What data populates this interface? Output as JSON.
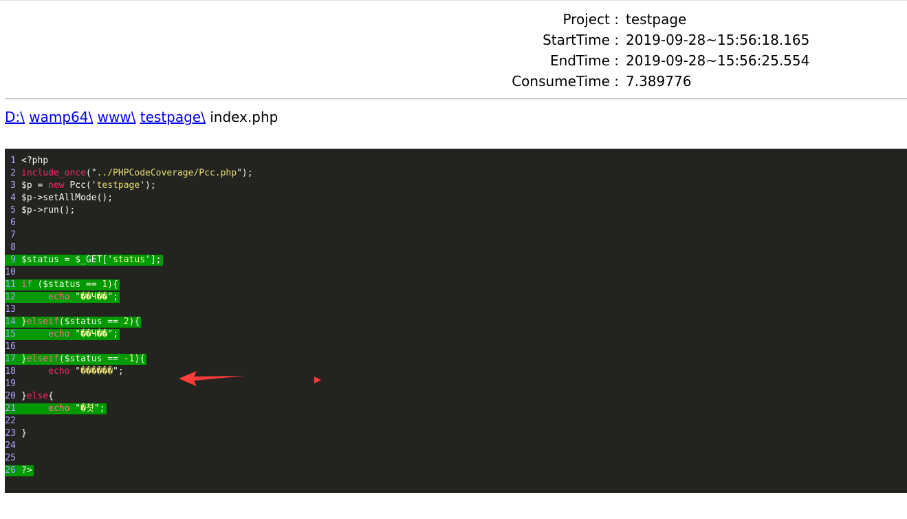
{
  "meta": {
    "project_label": "Project :",
    "project": "testpage",
    "start_label": "StartTime :",
    "start": "2019-09-28~15:56:18.165",
    "end_label": "EndTime :",
    "end": "2019-09-28~15:56:25.554",
    "consume_label": "ConsumeTime :",
    "consume": "7.389776"
  },
  "breadcrumb": {
    "items": [
      "D:\\",
      "wamp64\\",
      "www\\",
      "testpage\\"
    ],
    "file": "index.php"
  },
  "code": {
    "covered_color": "#009900",
    "background": "#23241f",
    "lines": [
      {
        "n": "1",
        "covered": false,
        "tokens": [
          [
            "plain",
            "<?php"
          ]
        ]
      },
      {
        "n": "2",
        "covered": false,
        "tokens": [
          [
            "kw",
            "include_once"
          ],
          [
            "plain",
            "(\""
          ],
          [
            "str",
            "../PHPCodeCoverage/Pcc.php"
          ],
          [
            "plain",
            "\");"
          ]
        ]
      },
      {
        "n": "3",
        "covered": false,
        "tokens": [
          [
            "plain",
            "$p = "
          ],
          [
            "kw",
            "new"
          ],
          [
            "plain",
            " Pcc('"
          ],
          [
            "str",
            "testpage"
          ],
          [
            "plain",
            "');"
          ]
        ]
      },
      {
        "n": "4",
        "covered": false,
        "tokens": [
          [
            "plain",
            "$p->setAllMode();"
          ]
        ]
      },
      {
        "n": "5",
        "covered": false,
        "tokens": [
          [
            "plain",
            "$p->run();"
          ]
        ]
      },
      {
        "n": "6",
        "covered": false,
        "tokens": []
      },
      {
        "n": "7",
        "covered": false,
        "tokens": []
      },
      {
        "n": "8",
        "covered": false,
        "tokens": []
      },
      {
        "n": "9",
        "covered": true,
        "tokens": [
          [
            "plain",
            "$status = $_GET['"
          ],
          [
            "str",
            "status"
          ],
          [
            "plain",
            "'];"
          ]
        ]
      },
      {
        "n": "10",
        "covered": false,
        "tokens": []
      },
      {
        "n": "11",
        "covered": true,
        "tokens": [
          [
            "kw",
            "if"
          ],
          [
            "plain",
            " ($status == "
          ],
          [
            "num",
            "1"
          ],
          [
            "plain",
            "){"
          ]
        ]
      },
      {
        "n": "12",
        "covered": true,
        "tokens": [
          [
            "plain",
            "     "
          ],
          [
            "kw",
            "echo"
          ],
          [
            "plain",
            " \""
          ],
          [
            "str",
            "��Ч��"
          ],
          [
            "plain",
            "\";"
          ]
        ]
      },
      {
        "n": "13",
        "covered": false,
        "tokens": []
      },
      {
        "n": "14",
        "covered": true,
        "tokens": [
          [
            "plain",
            "}"
          ],
          [
            "kw",
            "elseif"
          ],
          [
            "plain",
            "($status == "
          ],
          [
            "num",
            "2"
          ],
          [
            "plain",
            "){"
          ]
        ]
      },
      {
        "n": "15",
        "covered": true,
        "tokens": [
          [
            "plain",
            "     "
          ],
          [
            "kw",
            "echo"
          ],
          [
            "plain",
            " \""
          ],
          [
            "str",
            "��Ч��"
          ],
          [
            "plain",
            "\";"
          ]
        ]
      },
      {
        "n": "16",
        "covered": false,
        "tokens": []
      },
      {
        "n": "17",
        "covered": true,
        "tokens": [
          [
            "plain",
            "}"
          ],
          [
            "kw",
            "elseif"
          ],
          [
            "plain",
            "($status == "
          ],
          [
            "num",
            "-1"
          ],
          [
            "plain",
            "){"
          ]
        ]
      },
      {
        "n": "18",
        "covered": false,
        "tokens": [
          [
            "plain",
            "     "
          ],
          [
            "kw",
            "echo"
          ],
          [
            "plain",
            " \""
          ],
          [
            "str",
            "������"
          ],
          [
            "plain",
            "\";"
          ]
        ]
      },
      {
        "n": "19",
        "covered": false,
        "tokens": []
      },
      {
        "n": "20",
        "covered": false,
        "tokens": [
          [
            "plain",
            "}"
          ],
          [
            "kw",
            "else"
          ],
          [
            "plain",
            "{"
          ]
        ]
      },
      {
        "n": "21",
        "covered": true,
        "tokens": [
          [
            "plain",
            "     "
          ],
          [
            "kw",
            "echo"
          ],
          [
            "plain",
            " \""
          ],
          [
            "str",
            "�쳣"
          ],
          [
            "plain",
            "\";"
          ]
        ]
      },
      {
        "n": "22",
        "covered": false,
        "tokens": []
      },
      {
        "n": "23",
        "covered": false,
        "tokens": [
          [
            "plain",
            "}"
          ]
        ]
      },
      {
        "n": "24",
        "covered": false,
        "tokens": []
      },
      {
        "n": "25",
        "covered": false,
        "tokens": []
      },
      {
        "n": "26",
        "covered": true,
        "tokens": [
          [
            "plain",
            "?>"
          ]
        ]
      }
    ]
  },
  "annotation": {
    "arrow_color": "#ff3b3b"
  }
}
